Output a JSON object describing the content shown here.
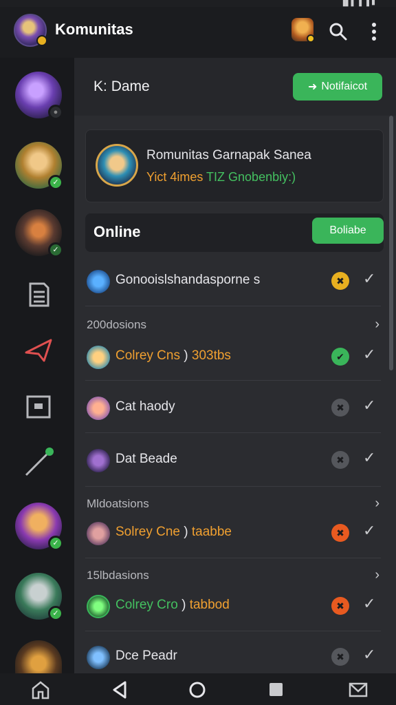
{
  "status": {
    "text": "▐▌▌▐ ▐ ▮"
  },
  "app": {
    "title": "Komunitas",
    "badge_color": "#e8b020"
  },
  "topbar": {
    "icons": [
      "game-icon",
      "search-icon",
      "more-vert-icon"
    ]
  },
  "sidebar": {
    "servers": [
      "server-avatar-1",
      "server-avatar-2",
      "server-avatar-3",
      "server-avatar-4",
      "server-avatar-5",
      "server-avatar-6"
    ],
    "nav_icons": [
      "document-icon",
      "send-icon",
      "frame-icon",
      "tool-icon"
    ]
  },
  "header": {
    "name": "Dame",
    "prefix": "K:",
    "notif_button": "Notifaicot",
    "accent": "#3ab55a"
  },
  "card": {
    "title": "Romunitas Garnapak Sanea",
    "subtitle_orange": "Yict 4imes",
    "subtitle_green": "TIZ Gnobenbiy:)"
  },
  "online": {
    "label": "Online",
    "button": "Boliabe"
  },
  "sections": {
    "s1": "200dosions",
    "s2": "Mldoatsions",
    "s3": "15lbdasions"
  },
  "rows": [
    {
      "name": "Gonooislshandasporne s",
      "status": "✖",
      "status_color": "#e8b020"
    },
    {
      "name_orange": "Colrey Cns",
      "name_rest": ")",
      "name_orange2": "303tbs",
      "status": "✔",
      "status_color": "#3ab55a"
    },
    {
      "name": "Cat haody",
      "status": "✖",
      "status_color": "#55575c"
    },
    {
      "name": "Dat Beade",
      "status": "✖",
      "status_color": "#55575c"
    },
    {
      "name_orange": "Solrey Cne",
      "name_rest": ")",
      "name_orange2": "taabbe",
      "status": "✖",
      "status_color": "#e85a20"
    },
    {
      "name_green": "Colrey Cro",
      "name_rest": ")",
      "name_orange2": "tabbod",
      "status": "✖",
      "status_color": "#e85a20"
    },
    {
      "name": "Dce Peadr",
      "status": "✖",
      "status_color": "#55575c"
    }
  ],
  "navbar": {
    "icons": [
      "home-icon",
      "back-icon",
      "home-circle-icon",
      "recents-icon",
      "mail-icon"
    ]
  }
}
